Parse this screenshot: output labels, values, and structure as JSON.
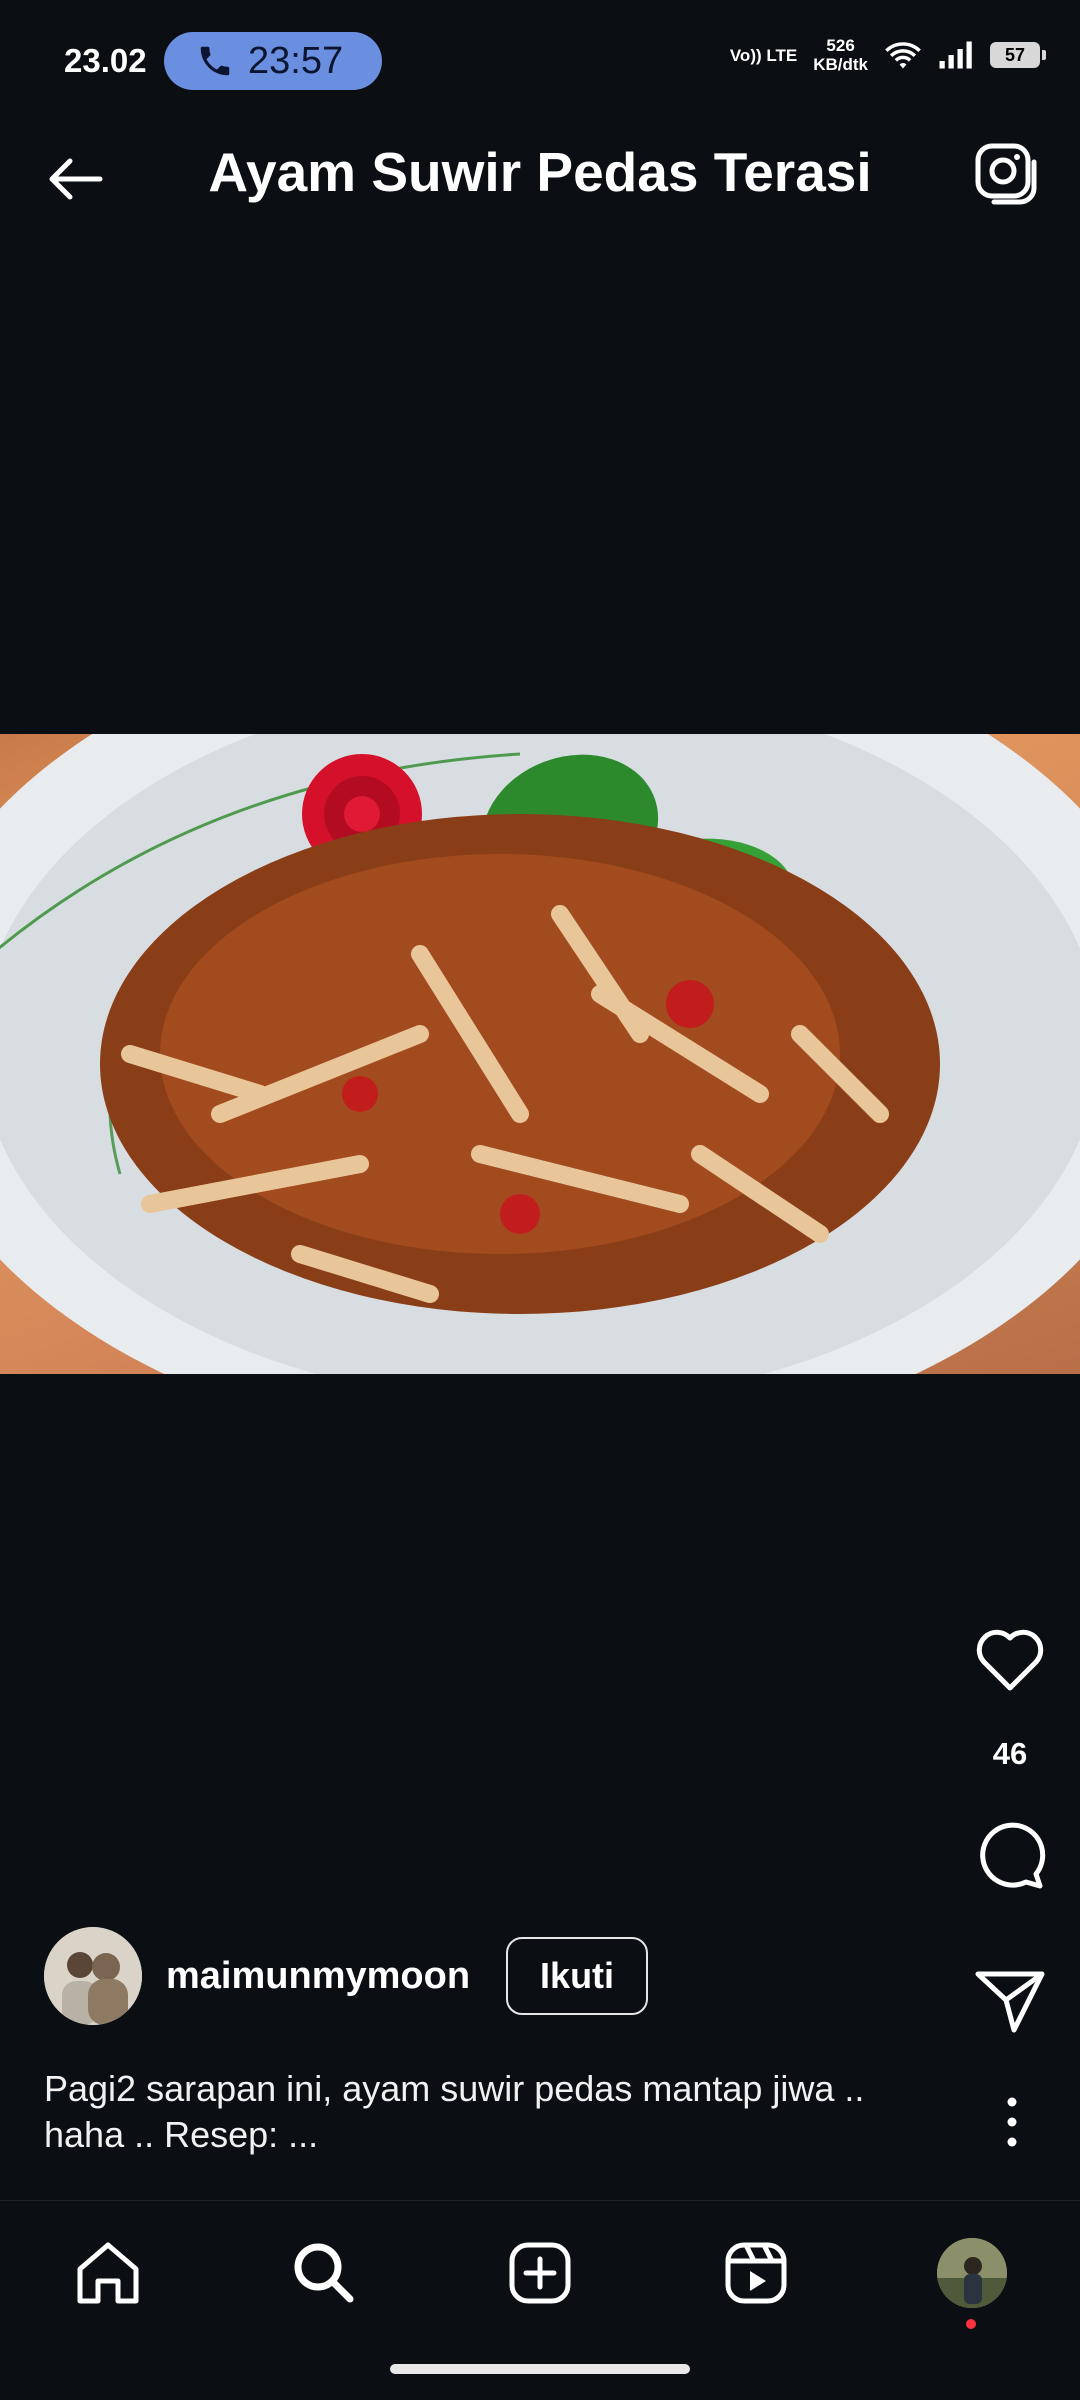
{
  "status_bar": {
    "time": "23.02",
    "call_timer": "23:57",
    "network_label": "Vo)) LTE",
    "net_speed_value": "526",
    "net_speed_unit": "KB/dtk",
    "battery": "57"
  },
  "header": {
    "title": "Ayam Suwir Pedas Terasi"
  },
  "post": {
    "likes": "46",
    "author": "maimunmymoon",
    "follow_label": "Ikuti",
    "caption": "Pagi2 sarapan ini, ayam suwir pedas mantap jiwa .. haha .. Resep: ..."
  },
  "icons": {
    "back": "arrow-left-icon",
    "camera": "camera-icon",
    "like": "heart-icon",
    "comment": "comment-icon",
    "share": "send-icon",
    "more": "more-vertical-icon",
    "nav": [
      "home-icon",
      "search-icon",
      "add-icon",
      "reels-icon",
      "profile-avatar"
    ]
  },
  "colors": {
    "background": "#0b0e13",
    "call_pill": "#6b8fe0",
    "notification_dot": "#ff3040"
  }
}
